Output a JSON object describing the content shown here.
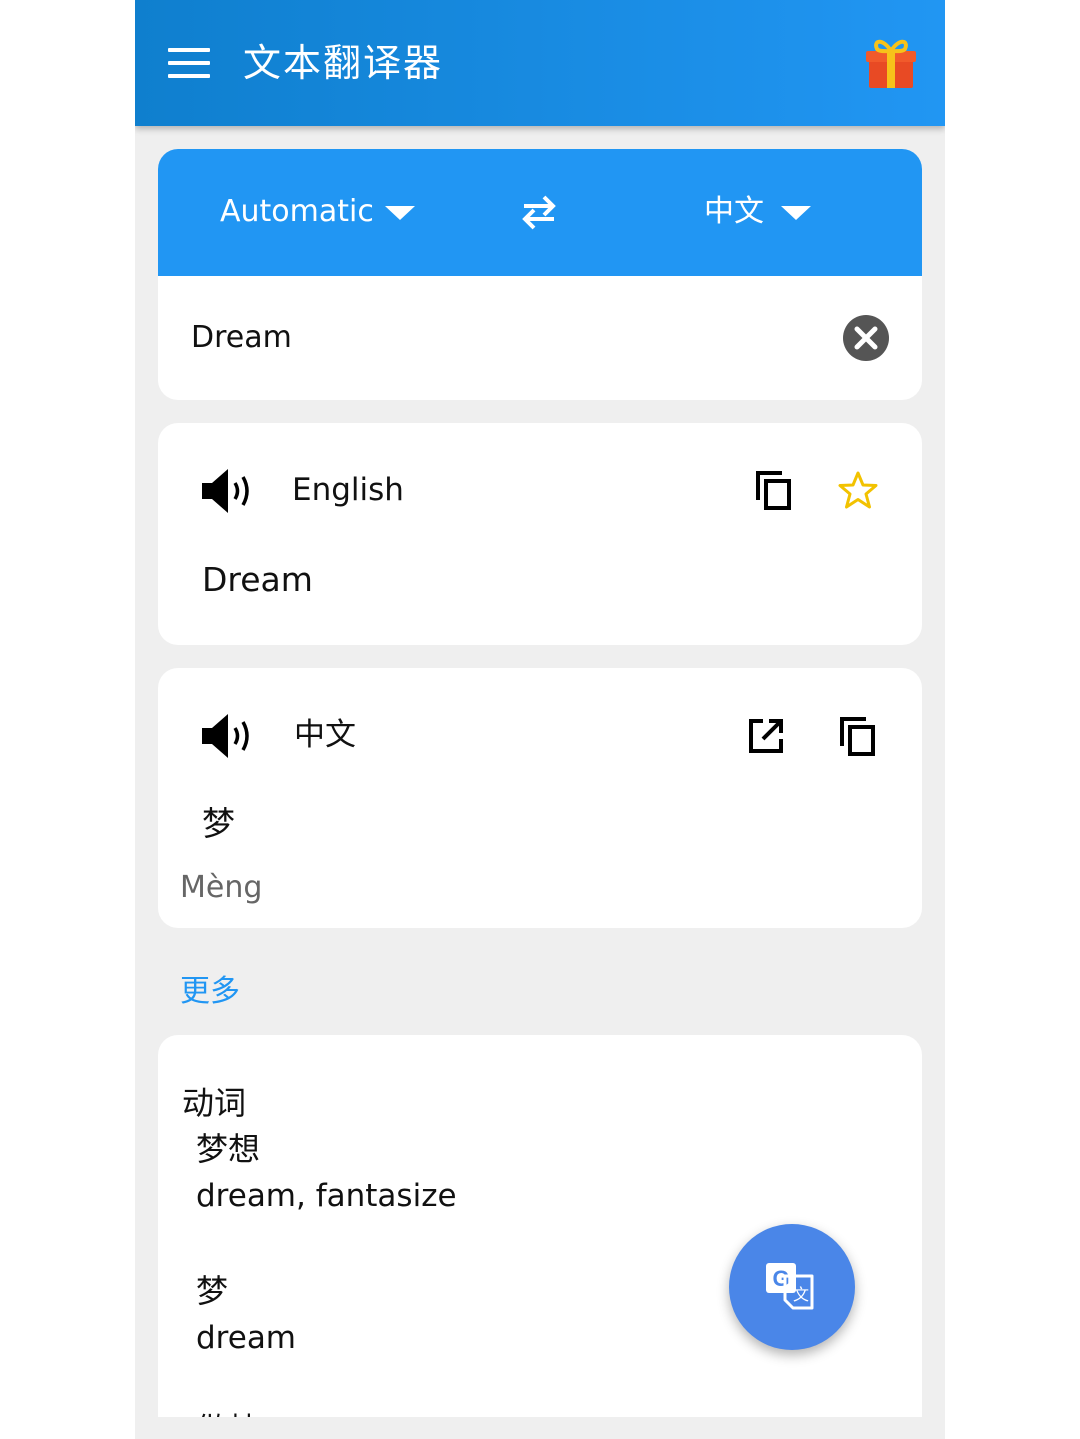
{
  "appbar": {
    "title": "文本翻译器"
  },
  "language_bar": {
    "source": "Automatic",
    "target": "中文"
  },
  "input": {
    "text": "Dream"
  },
  "source_result": {
    "language": "English",
    "text": "Dream"
  },
  "target_result": {
    "language": "中文",
    "text": "梦",
    "pinyin": "Mèng"
  },
  "more": {
    "label": "更多"
  },
  "dictionary": {
    "part_of_speech": "动词",
    "entries": [
      {
        "word": "梦想",
        "synonyms": "dream,  fantasize"
      },
      {
        "word": "梦",
        "synonyms": "dream"
      }
    ],
    "truncated_next": "做梦"
  },
  "colors": {
    "primary": "#2196f3",
    "appbar_dark": "#0f7fce",
    "fab": "#4a86e8",
    "star": "#f2c200",
    "background": "#efefef"
  }
}
